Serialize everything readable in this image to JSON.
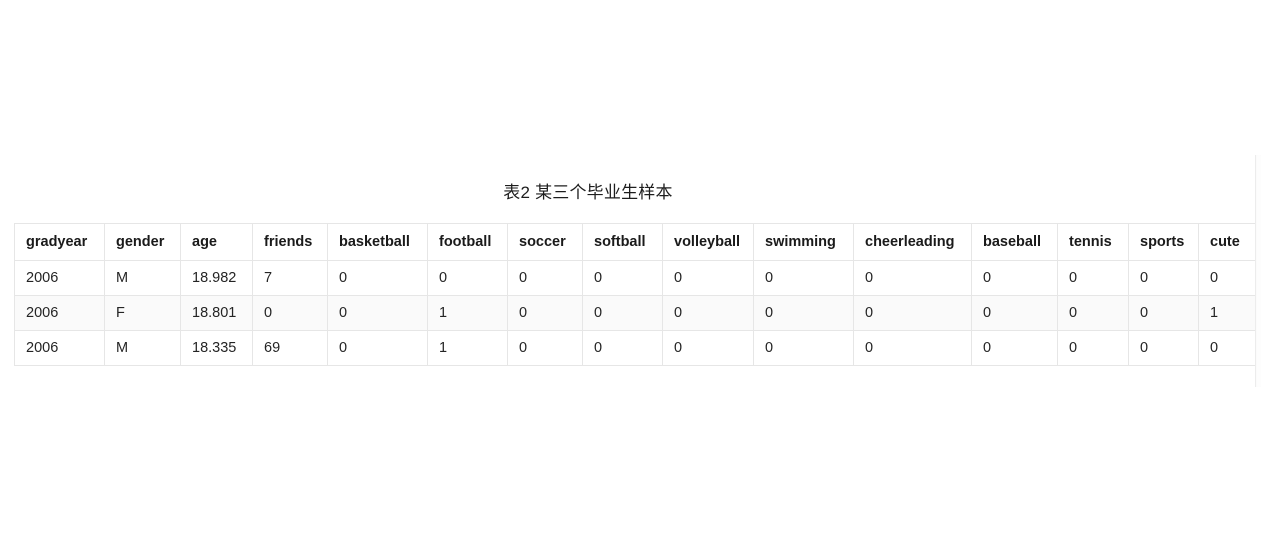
{
  "caption": "表2 某三个毕业生样本",
  "table": {
    "columns": [
      "gradyear",
      "gender",
      "age",
      "friends",
      "basketball",
      "football",
      "soccer",
      "softball",
      "volleyball",
      "swimming",
      "cheerleading",
      "baseball",
      "tennis",
      "sports",
      "cute"
    ],
    "rows": [
      [
        "2006",
        "M",
        "18.982",
        "7",
        "0",
        "0",
        "0",
        "0",
        "0",
        "0",
        "0",
        "0",
        "0",
        "0",
        "0"
      ],
      [
        "2006",
        "F",
        "18.801",
        "0",
        "0",
        "1",
        "0",
        "0",
        "0",
        "0",
        "0",
        "0",
        "0",
        "0",
        "1"
      ],
      [
        "2006",
        "M",
        "18.335",
        "69",
        "0",
        "1",
        "0",
        "0",
        "0",
        "0",
        "0",
        "0",
        "0",
        "0",
        "0"
      ]
    ]
  },
  "scrollbar": {
    "orientation": "vertical",
    "position": "right"
  },
  "colors": {
    "page_background": "#ffffff",
    "border": "#e6e6e6",
    "text": "#1a1a1a",
    "stripe": "#fafafa"
  }
}
